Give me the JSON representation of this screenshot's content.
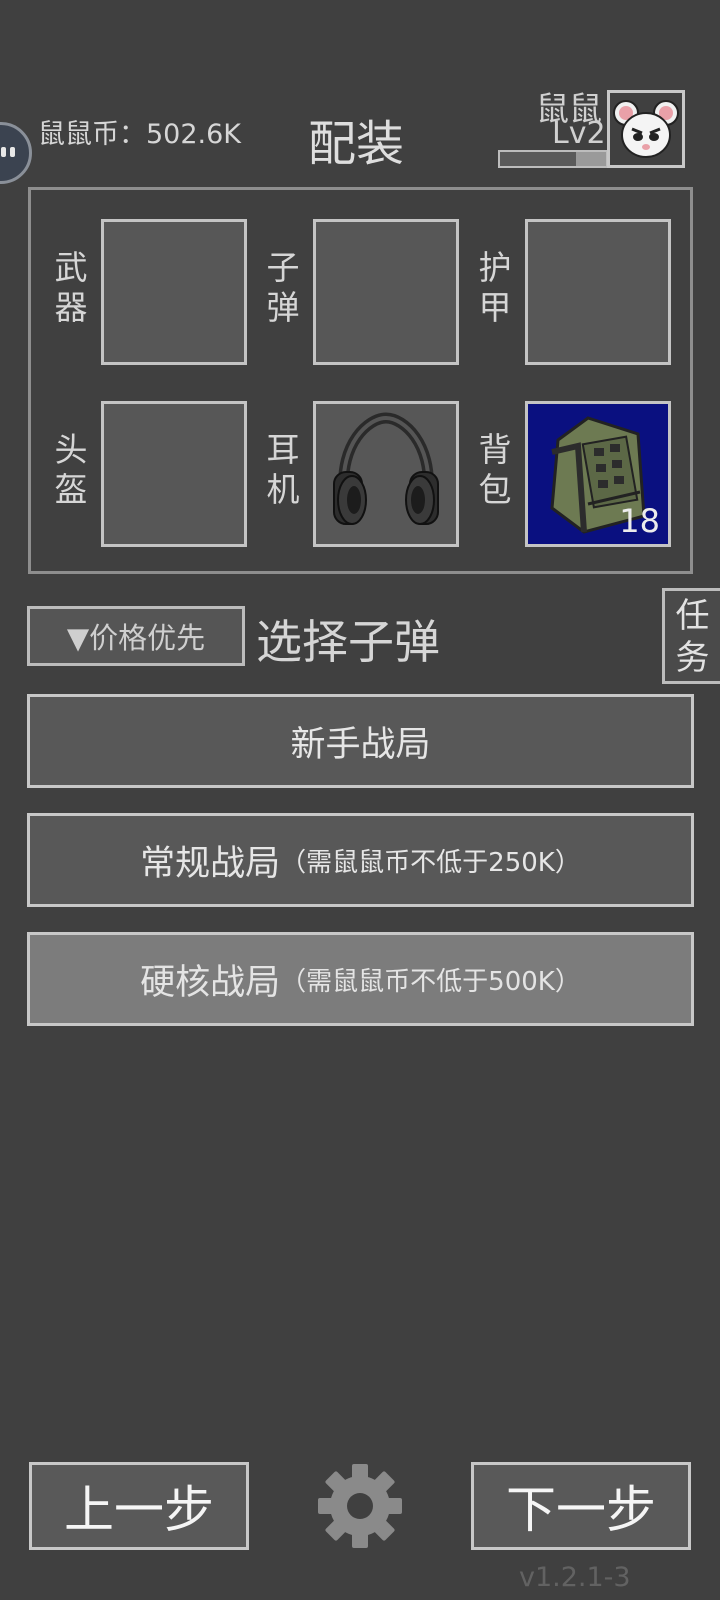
{
  "header": {
    "coin_label": "鼠鼠币：",
    "coin_value": "502.6K",
    "title": "配装",
    "player_name": "鼠鼠",
    "player_level": "Lv2",
    "xp_progress": 0.72
  },
  "equipment": {
    "slots": [
      {
        "label_line1": "武",
        "label_line2": "器",
        "item": ""
      },
      {
        "label_line1": "子",
        "label_line2": "弹",
        "item": ""
      },
      {
        "label_line1": "护",
        "label_line2": "甲",
        "item": ""
      },
      {
        "label_line1": "头",
        "label_line2": "盔",
        "item": ""
      },
      {
        "label_line1": "耳",
        "label_line2": "机",
        "item": "headphones-icon"
      },
      {
        "label_line1": "背",
        "label_line2": "包",
        "item": "backpack-icon",
        "count": "18"
      }
    ]
  },
  "ammo": {
    "sort_label": "▼价格优先",
    "select_label": "选择子弹"
  },
  "task": {
    "line1": "任",
    "line2": "务"
  },
  "modes": [
    {
      "name": "新手战局",
      "requirement": ""
    },
    {
      "name": "常规战局",
      "requirement": "（需鼠鼠币不低于250K）"
    },
    {
      "name": "硬核战局",
      "requirement": "（需鼠鼠币不低于500K）"
    }
  ],
  "footer": {
    "prev_label": "上一步",
    "next_label": "下一步",
    "settings_icon": "gear-icon",
    "version": "v1.2.1-3"
  },
  "colors": {
    "background": "#404040",
    "backpack_bg": "#0a1080",
    "border": "#c8c8c8"
  }
}
